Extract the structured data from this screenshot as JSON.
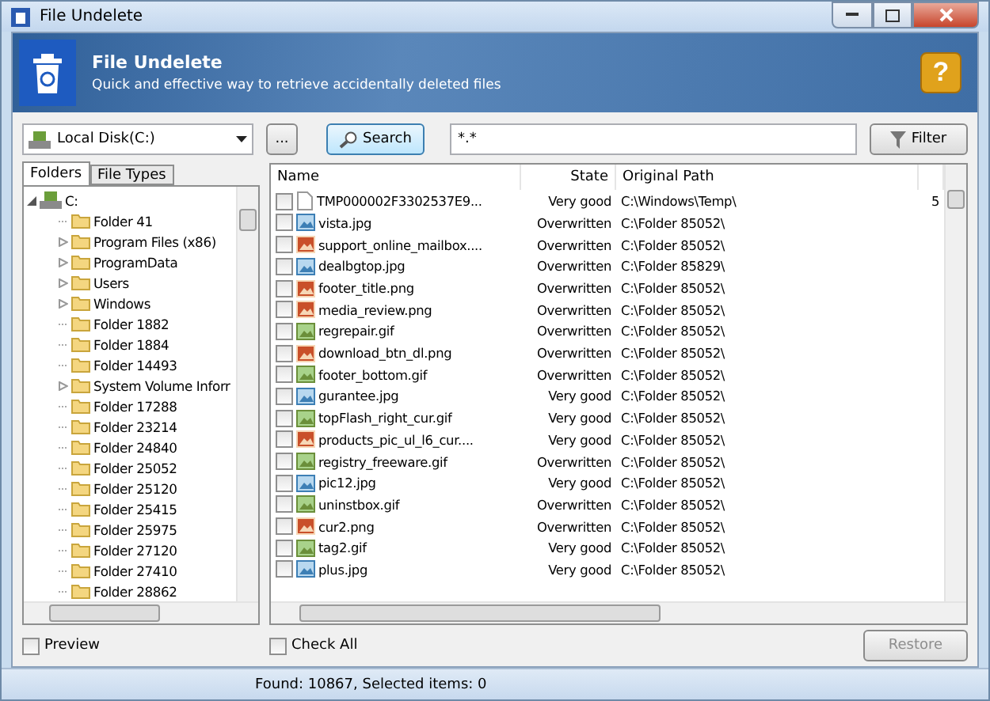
{
  "window": {
    "title": "File Undelete"
  },
  "header": {
    "title": "File Undelete",
    "subtitle": "Quick and effective way to retrieve accidentally deleted files",
    "help_label": "?"
  },
  "toolbar": {
    "drive": "Local Disk(C:)",
    "browse_label": "...",
    "search_label": "Search",
    "mask": "*.*",
    "filter_label": "Filter"
  },
  "left_tabs": [
    {
      "label": "Folders",
      "selected": true
    },
    {
      "label": "File Types",
      "selected": false
    }
  ],
  "tree": {
    "label": "C:",
    "expanded": true,
    "children": [
      {
        "label": "Folder 41",
        "has_children": false
      },
      {
        "label": "Program Files (x86)",
        "has_children": true
      },
      {
        "label": "ProgramData",
        "has_children": true
      },
      {
        "label": "Users",
        "has_children": true
      },
      {
        "label": "Windows",
        "has_children": true
      },
      {
        "label": "Folder 1882",
        "has_children": false
      },
      {
        "label": "Folder 1884",
        "has_children": false
      },
      {
        "label": "Folder 14493",
        "has_children": false
      },
      {
        "label": "System Volume Inforr",
        "has_children": true
      },
      {
        "label": "Folder 17288",
        "has_children": false
      },
      {
        "label": "Folder 23214",
        "has_children": false
      },
      {
        "label": "Folder 24840",
        "has_children": false
      },
      {
        "label": "Folder 25052",
        "has_children": false
      },
      {
        "label": "Folder 25120",
        "has_children": false
      },
      {
        "label": "Folder 25415",
        "has_children": false
      },
      {
        "label": "Folder 25975",
        "has_children": false
      },
      {
        "label": "Folder 27120",
        "has_children": false
      },
      {
        "label": "Folder 27410",
        "has_children": false
      },
      {
        "label": "Folder 28862",
        "has_children": false
      }
    ]
  },
  "table": {
    "columns": [
      "Name",
      "State",
      "Original Path"
    ],
    "rows": [
      {
        "kind": "file",
        "name": "TMP000002F3302537E9...",
        "state": "Very good",
        "path": "C:\\Windows\\Temp\\",
        "column_4": "5",
        "checked": false
      },
      {
        "kind": "jpg",
        "name": "vista.jpg",
        "state": "Overwritten",
        "path": "C:\\Folder 85052\\",
        "checked": false
      },
      {
        "kind": "png",
        "name": "support_online_mailbox....",
        "state": "Overwritten",
        "path": "C:\\Folder 85052\\",
        "checked": false
      },
      {
        "kind": "jpg",
        "name": "dealbgtop.jpg",
        "state": "Overwritten",
        "path": "C:\\Folder 85829\\",
        "checked": false
      },
      {
        "kind": "png",
        "name": "footer_title.png",
        "state": "Overwritten",
        "path": "C:\\Folder 85052\\",
        "checked": false
      },
      {
        "kind": "png",
        "name": "media_review.png",
        "state": "Overwritten",
        "path": "C:\\Folder 85052\\",
        "checked": false
      },
      {
        "kind": "gif",
        "name": "regrepair.gif",
        "state": "Overwritten",
        "path": "C:\\Folder 85052\\",
        "checked": false
      },
      {
        "kind": "png",
        "name": "download_btn_dl.png",
        "state": "Overwritten",
        "path": "C:\\Folder 85052\\",
        "checked": false
      },
      {
        "kind": "gif",
        "name": "footer_bottom.gif",
        "state": "Overwritten",
        "path": "C:\\Folder 85052\\",
        "checked": false
      },
      {
        "kind": "jpg",
        "name": "gurantee.jpg",
        "state": "Very good",
        "path": "C:\\Folder 85052\\",
        "checked": false
      },
      {
        "kind": "gif",
        "name": "topFlash_right_cur.gif",
        "state": "Very good",
        "path": "C:\\Folder 85052\\",
        "checked": false
      },
      {
        "kind": "png",
        "name": "products_pic_ul_l6_cur....",
        "state": "Very good",
        "path": "C:\\Folder 85052\\",
        "checked": false
      },
      {
        "kind": "gif",
        "name": "registry_freeware.gif",
        "state": "Overwritten",
        "path": "C:\\Folder 85052\\",
        "checked": false
      },
      {
        "kind": "jpg",
        "name": "pic12.jpg",
        "state": "Very good",
        "path": "C:\\Folder 85052\\",
        "checked": false
      },
      {
        "kind": "gif",
        "name": "uninstbox.gif",
        "state": "Overwritten",
        "path": "C:\\Folder 85052\\",
        "checked": false
      },
      {
        "kind": "png",
        "name": "cur2.png",
        "state": "Overwritten",
        "path": "C:\\Folder 85052\\",
        "checked": false
      },
      {
        "kind": "gif",
        "name": "tag2.gif",
        "state": "Very good",
        "path": "C:\\Folder 85052\\",
        "checked": false
      },
      {
        "kind": "jpg",
        "name": "plus.jpg",
        "state": "Very good",
        "path": "C:\\Folder 85052\\",
        "checked": false
      }
    ]
  },
  "preview": {
    "label": "Preview",
    "checked": false
  },
  "check_all": {
    "label": "Check All",
    "checked": false
  },
  "restore": {
    "label": "Restore",
    "disabled": true
  },
  "status_bar": {
    "text": "Found: 10867, Selected items: 0"
  }
}
